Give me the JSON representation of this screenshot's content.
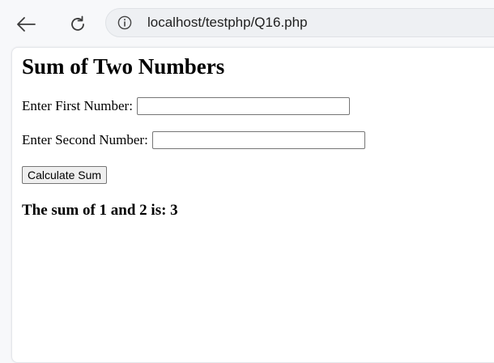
{
  "browser": {
    "url": "localhost/testphp/Q16.php",
    "icons": {
      "back": "back-arrow-icon",
      "reload": "reload-icon",
      "site_info": "info-icon"
    }
  },
  "page": {
    "title": "Sum of Two Numbers",
    "first_label": "Enter First Number:",
    "first_value": "",
    "second_label": "Enter Second Number:",
    "second_value": "",
    "button_label": "Calculate Sum",
    "result_text": "The sum of 1 and 2 is: 3"
  }
}
